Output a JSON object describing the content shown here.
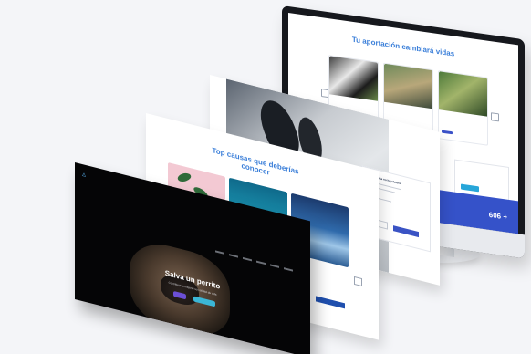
{
  "scene": {
    "description_label": "",
    "monitor": {
      "heading": "Tu aportación cambiará vidas",
      "banner_text": "606 +",
      "card_titles": [
        "",
        "",
        ""
      ]
    },
    "page_mid": {
      "heading_line1": "Top causas que deberías",
      "heading_line2": "conocer",
      "panel_title": "Ole planeta no hay futuro"
    },
    "page_front": {
      "title": "Salva un perrito",
      "subtitle": "Contribuye a mejorar su calidad de vida"
    }
  },
  "colors": {
    "accent_blue": "#3b7fd9",
    "banner_blue": "#3552c9",
    "button_purple": "#6b4fd6",
    "button_cyan": "#3bb6d6"
  }
}
